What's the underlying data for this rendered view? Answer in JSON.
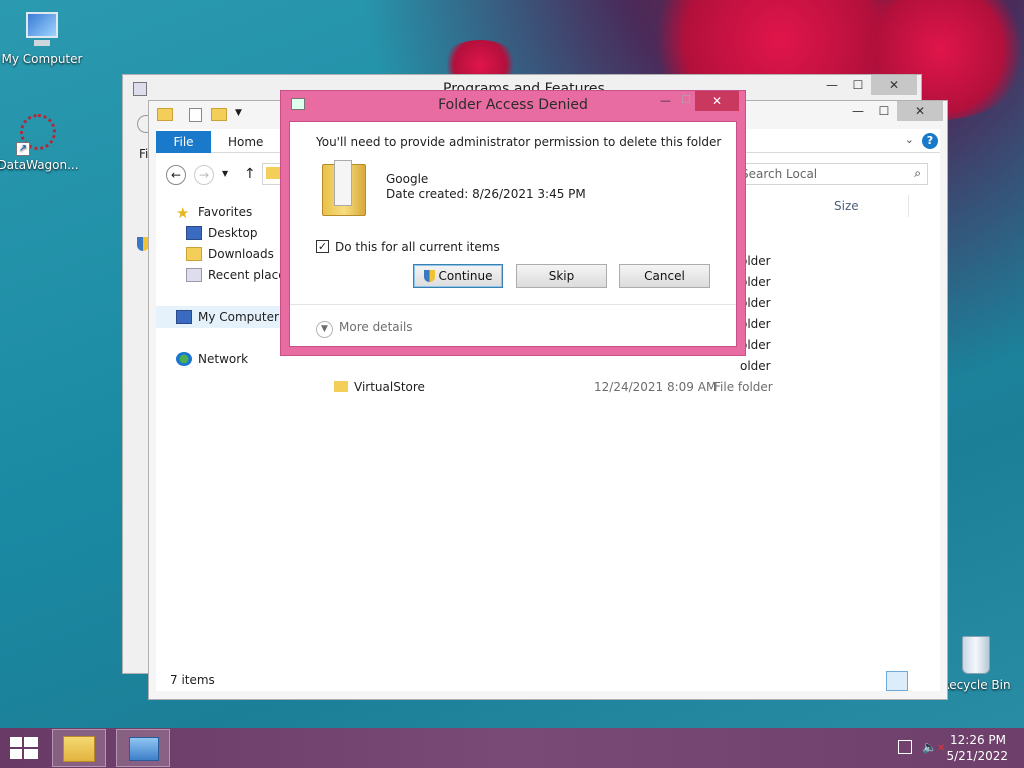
{
  "desktop": {
    "icons": [
      {
        "label": "My Computer"
      },
      {
        "label": "DataWagon..."
      },
      {
        "label": "Recycle Bin"
      }
    ]
  },
  "back_window": {
    "title": "Programs and Features",
    "left_edge_text": "Fi"
  },
  "explorer": {
    "tabs": {
      "file": "File",
      "home": "Home"
    },
    "search_placeholder": "Search Local",
    "column_size": "Size",
    "nav": {
      "favorites": "Favorites",
      "desktop": "Desktop",
      "downloads": "Downloads",
      "recent": "Recent places",
      "my_computer": "My Computer",
      "network": "Network"
    },
    "type_fragment": "older",
    "last_row": {
      "name": "VirtualStore",
      "date": "12/24/2021 8:09 AM",
      "type": "File folder"
    },
    "status": "7 items"
  },
  "dialog": {
    "title": "Folder Access Denied",
    "message": "You'll need to provide administrator permission to delete this folder",
    "item_name": "Google",
    "item_date": "Date created: 8/26/2021 3:45 PM",
    "checkbox_label": "Do this for all current items",
    "checkbox_checked": true,
    "continue_label": "Continue",
    "skip_label": "Skip",
    "cancel_label": "Cancel",
    "more_details": "More details"
  },
  "taskbar": {
    "time": "12:26 PM",
    "date": "5/21/2022"
  },
  "colors": {
    "accent": "#1979ca",
    "dialog_frame": "#e86ca1",
    "taskbar": "#6d3f6a"
  }
}
